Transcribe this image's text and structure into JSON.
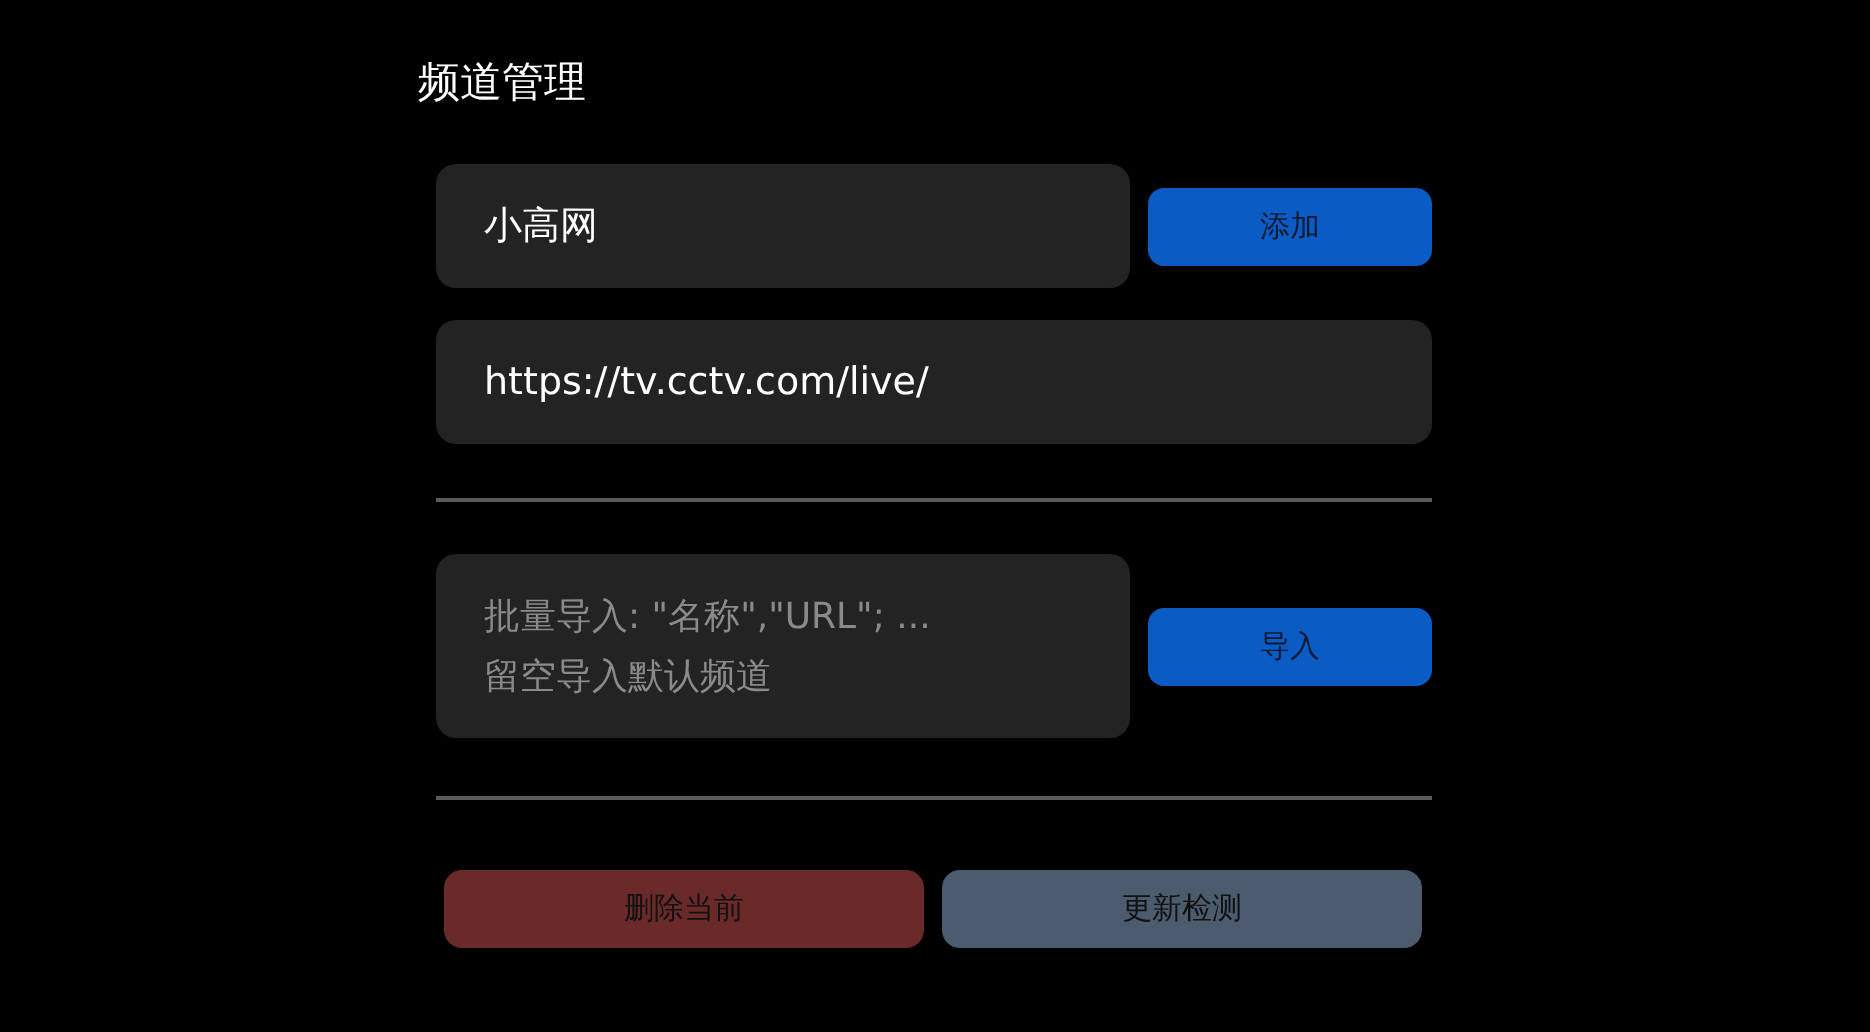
{
  "title": "频道管理",
  "name_field": {
    "value": "小高网"
  },
  "add_button": "添加",
  "url_field": {
    "value": "https://tv.cctv.com/live/"
  },
  "import_field": {
    "placeholder": "批量导入: \"名称\",\"URL\"; ...\n留空导入默认频道"
  },
  "import_button": "导入",
  "actions": [
    {
      "label": "删除当前",
      "kind": "danger"
    },
    {
      "label": "更新检测",
      "kind": "neutral"
    }
  ]
}
